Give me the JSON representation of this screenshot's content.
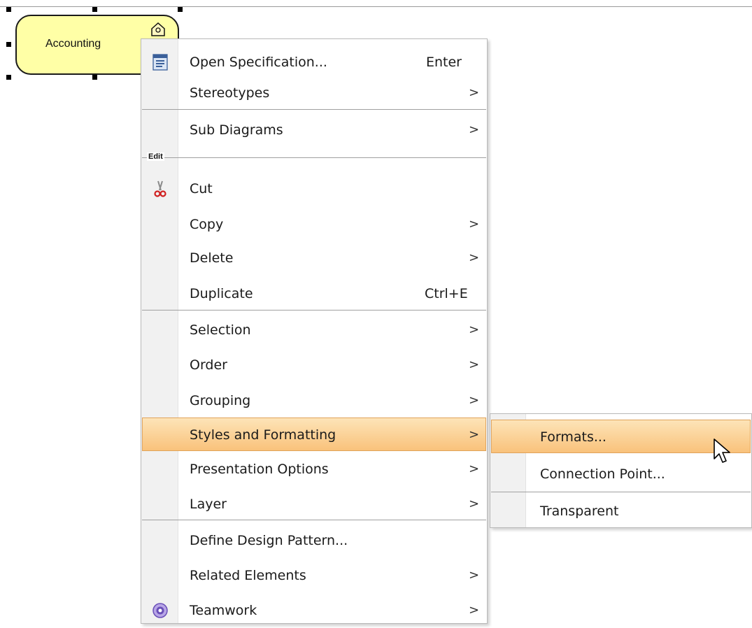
{
  "diagram": {
    "element_label": "Accounting",
    "element_icon": "building-icon",
    "fill": "#ffffa6"
  },
  "context_menu": {
    "items": [
      {
        "label": "Open Specification...",
        "shortcut": "Enter",
        "icon": "specification-icon"
      },
      {
        "label": "Stereotypes",
        "submenu_arrow": ">"
      },
      {
        "label": "Sub Diagrams",
        "submenu_arrow": ">"
      },
      {
        "label": "Cut",
        "icon": "scissors-icon"
      },
      {
        "label": "Copy",
        "submenu_arrow": ">"
      },
      {
        "label": "Delete",
        "submenu_arrow": ">"
      },
      {
        "label": "Duplicate",
        "shortcut": "Ctrl+E"
      },
      {
        "label": "Selection",
        "submenu_arrow": ">"
      },
      {
        "label": "Order",
        "submenu_arrow": ">"
      },
      {
        "label": "Grouping",
        "submenu_arrow": ">"
      },
      {
        "label": "Styles and Formatting",
        "submenu_arrow": ">",
        "highlighted": true
      },
      {
        "label": "Presentation Options",
        "submenu_arrow": ">"
      },
      {
        "label": "Layer",
        "submenu_arrow": ">"
      },
      {
        "label": "Define Design Pattern..."
      },
      {
        "label": "Related Elements",
        "submenu_arrow": ">"
      },
      {
        "label": "Teamwork",
        "submenu_arrow": ">",
        "icon": "teamwork-icon"
      }
    ],
    "group_label_edit": "Edit"
  },
  "submenu": {
    "items": [
      {
        "label": "Formats...",
        "highlighted": true
      },
      {
        "label": "Connection Point..."
      },
      {
        "label": "Transparent"
      }
    ]
  },
  "colors": {
    "highlight": "#f9c27b",
    "menu_border": "#b9b9b9"
  }
}
